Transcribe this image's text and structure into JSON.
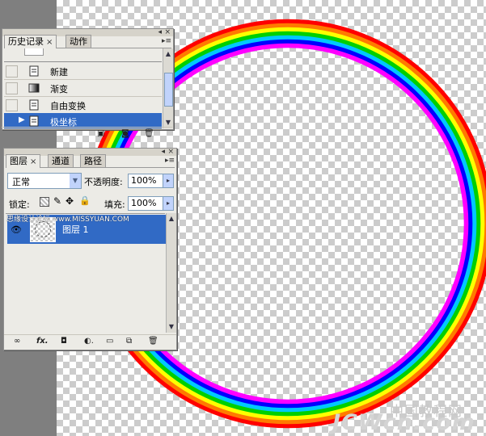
{
  "colors": {
    "workspace": "#7f7f7f",
    "panel": "#ecebe6",
    "selection": "#316ac5",
    "rainbow": [
      "#ff0000",
      "#ff7a00",
      "#ffff00",
      "#00d000",
      "#00c8ff",
      "#0000ff",
      "#ff00ff"
    ]
  },
  "history_panel": {
    "tabs": [
      {
        "label": "历史记录",
        "close": "×"
      },
      {
        "label": "动作"
      }
    ],
    "items": [
      {
        "label": "新建",
        "icon": "document-icon"
      },
      {
        "label": "渐变",
        "icon": "gradient-icon"
      },
      {
        "label": "自由变换",
        "icon": "document-icon"
      },
      {
        "label": "极坐标",
        "icon": "document-icon",
        "selected": true
      }
    ],
    "footer_icons": [
      "new-document-from-state-icon",
      "snapshot-icon",
      "trash-icon"
    ]
  },
  "layers_panel": {
    "tabs": [
      {
        "label": "图层",
        "close": "×"
      },
      {
        "label": "通道"
      },
      {
        "label": "路径"
      }
    ],
    "blend_mode": "正常",
    "opacity_label": "不透明度:",
    "opacity_value": "100%",
    "lock_label": "锁定:",
    "fill_label": "填充:",
    "fill_value": "100%",
    "layers": [
      {
        "name": "图层 1",
        "visible": true,
        "selected": true
      }
    ],
    "footer_icons": [
      "link-icon",
      "fx-icon",
      "mask-icon",
      "adjustment-icon",
      "group-folder-icon",
      "new-layer-icon",
      "trash-icon"
    ]
  },
  "watermarks": {
    "top": "思缘设计论坛 www.MISSYUAN.COM",
    "bottom_cn": "中国教程网",
    "bottom_en": "JCWcn.com"
  }
}
